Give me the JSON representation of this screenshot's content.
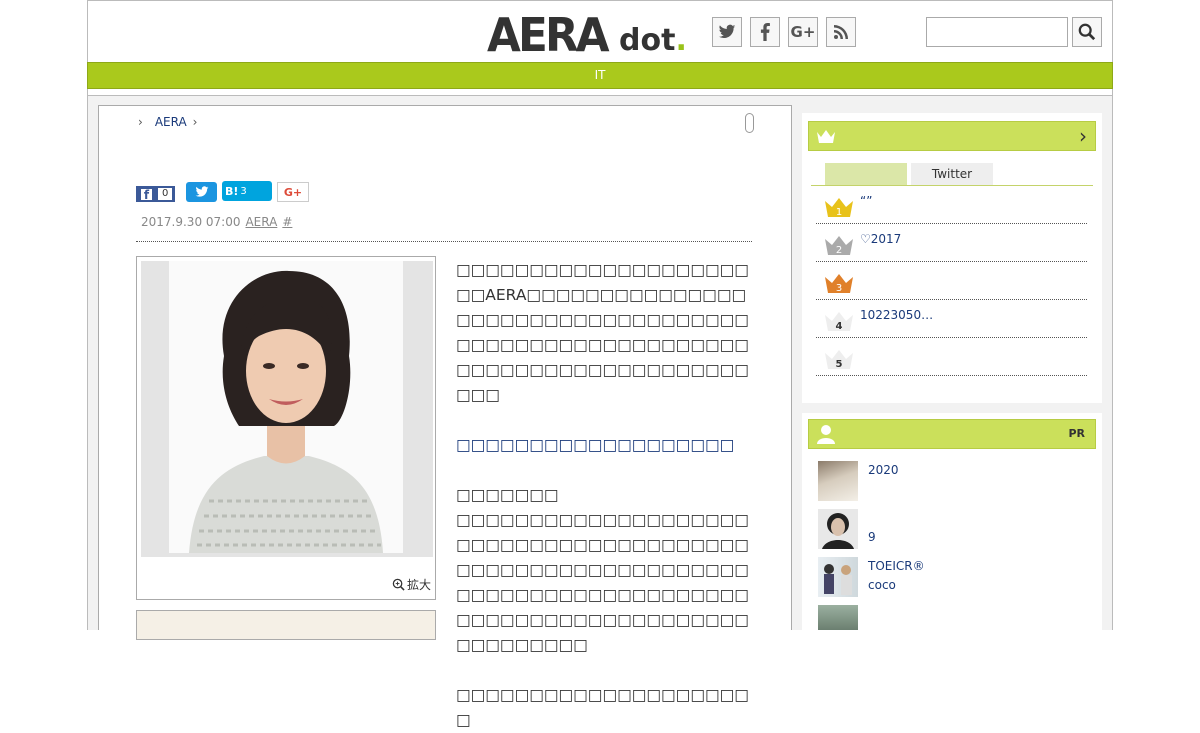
{
  "header": {
    "logo_main": "AERA",
    "logo_sub": "dot",
    "logo_period": ".",
    "social": [
      {
        "name": "twitter-icon"
      },
      {
        "name": "facebook-icon"
      },
      {
        "name": "google-plus-icon"
      },
      {
        "name": "rss-icon"
      }
    ],
    "search_value": ""
  },
  "nav": {
    "label": "IT"
  },
  "breadcrumb": {
    "item": "AERA"
  },
  "share": {
    "facebook_count": "0",
    "hatena_label": "B!",
    "hatena_count": "3",
    "gplus_label": "G+"
  },
  "meta": {
    "date": "2017.9.30 07:00",
    "source": "AERA",
    "hash": "#"
  },
  "photo": {
    "zoom_label": "拡大"
  },
  "body": {
    "para1": "□□□□□□□□□□□□□□□□□□□□□□AERA□□□□□□□□□□□□□□□□□□□□□□□□□□□□□□□□□□□□□□□□□□□□□□□□□□□□□□□□□□□□□□□□□□□□□□□□□□□□□□",
    "link": "□□□□□□□□□□□□□□□□□□□",
    "para2a": "□□□□□□□",
    "para2b": "□□□□□□□□□□□□□□□□□□□□□□□□□□□□□□□□□□□□□□□□□□□□□□□□□□□□□□□□□□□□□□□□□□□□□□□□□□□□□□□□□□□□□□□□□□□□□□□□□□□□□□□□□□□□□",
    "para3": "□□□□□□□□□□□□□□□□□□□□□"
  },
  "ranking": {
    "tabs": [
      "",
      "Twitter"
    ],
    "items": [
      {
        "rank": "1",
        "text": "“”",
        "color": "#e8c21a"
      },
      {
        "rank": "2",
        "text": "♡2017",
        "color": "#aaaaaa"
      },
      {
        "rank": "3",
        "text": "",
        "color": "#e0802a"
      },
      {
        "rank": "4",
        "text": "10223050…",
        "color": "#eeeeee"
      },
      {
        "rank": "5",
        "text": "",
        "color": "#eeeeee"
      }
    ]
  },
  "pr": {
    "label": "PR",
    "items": [
      {
        "line1": "2020",
        "line2": ""
      },
      {
        "line1": "9",
        "line2": ""
      },
      {
        "line1": "TOEICR®",
        "line2": "coco"
      },
      {
        "line1": "",
        "line2": ""
      }
    ]
  },
  "colors": {
    "accent": "#aac91c",
    "sidebar_head": "#cbe05b",
    "link": "#1a3a7a"
  }
}
